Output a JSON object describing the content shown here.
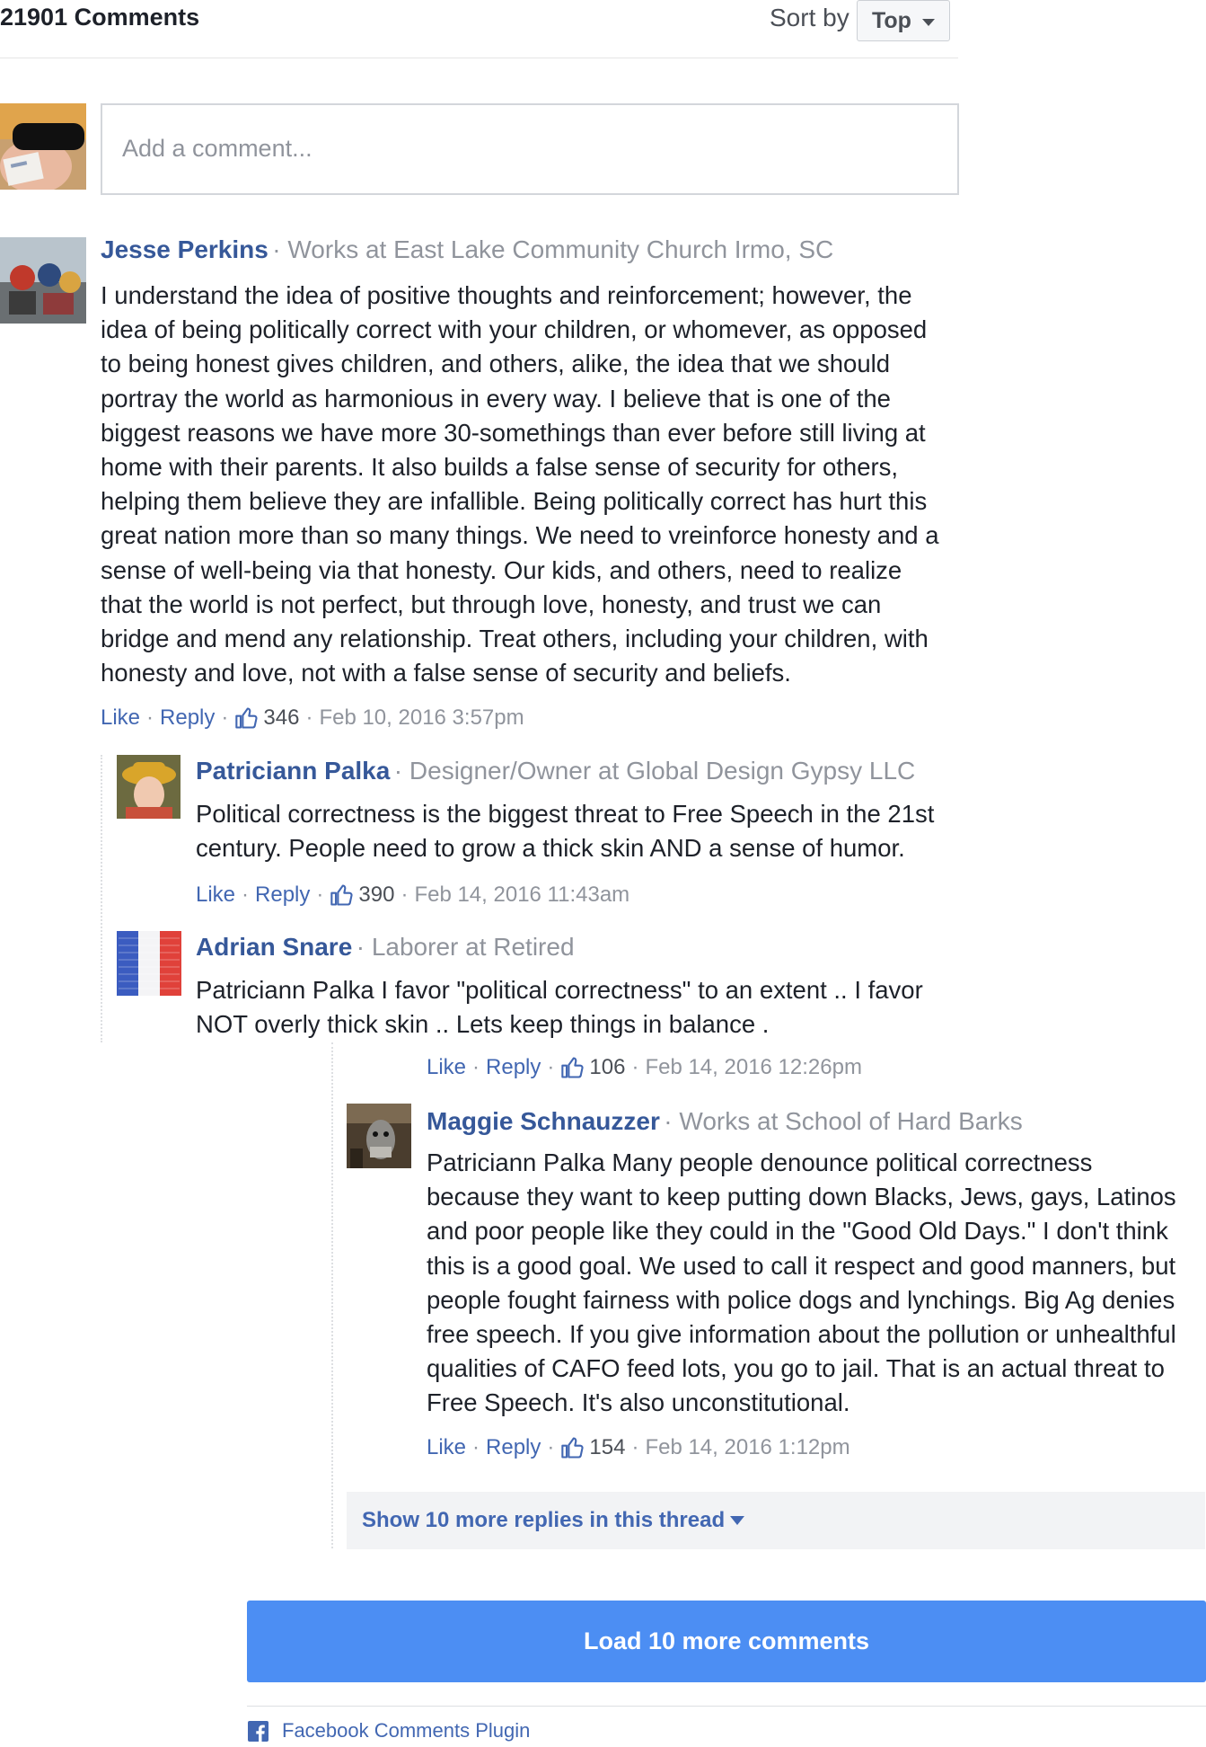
{
  "header": {
    "comment_count": "21901 Comments",
    "sort_label": "Sort by",
    "sort_value": "Top"
  },
  "composer": {
    "placeholder": "Add a comment..."
  },
  "comments": [
    {
      "name": "Jesse Perkins",
      "meta": "· Works at East Lake Community Church Irmo, SC",
      "lines": [
        "I understand the idea of positive thoughts and reinforcement; however, the",
        "idea of being politically correct with your children, or whomever, as opposed",
        "to being honest gives children, and others, alike, the idea that we should",
        "portray the world as harmonious in every way. I believe that is one of the",
        "biggest reasons we have more 30-somethings than ever before still living at",
        "home with their parents. It also builds a false sense of security for others,",
        "helping them believe they are infallible. Being politically correct has hurt this",
        "great nation more than so many things. We need to vreinforce honesty and a",
        "sense of well-being via that honesty. Our kids, and others, need to realize",
        "that the world is not perfect, but through love, honesty, and trust we can",
        "bridge and mend any relationship. Treat others, including your children, with",
        "honesty and love, not with a false sense of security and beliefs."
      ],
      "like": "Like",
      "reply": "Reply",
      "likes": "346",
      "timestamp": "Feb 10, 2016 3:57pm"
    },
    {
      "name": "Patriciann Palka",
      "meta": "· Designer/Owner at Global Design Gypsy LLC",
      "lines": [
        "Political correctness is the biggest threat to Free Speech in the 21st",
        "century. People need to grow a thick skin AND a sense of humor."
      ],
      "like": "Like",
      "reply": "Reply",
      "likes": "390",
      "timestamp": "Feb 14, 2016 11:43am"
    },
    {
      "name": "Adrian Snare",
      "meta": "· Laborer at Retired",
      "lines": [
        "Patriciann Palka I favor \"political correctness\" to an extent .. I favor",
        "NOT overly thick skin .. Lets keep things in balance ."
      ],
      "like": "Like",
      "reply": "Reply",
      "likes": "106",
      "timestamp": "Feb 14, 2016 12:26pm"
    },
    {
      "name": "Maggie Schnauzzer",
      "meta": "· Works at School of Hard Barks",
      "lines": [
        "Patriciann Palka Many people denounce political correctness",
        "because they want to keep putting down Blacks, Jews, gays, Latinos",
        "and poor people like they could in the \"Good Old Days.\" I don't think",
        "this is a good goal. We used to call it respect and good manners, but",
        "people fought fairness with police dogs and lynchings. Big Ag denies",
        "free speech. If you give information about the pollution or unhealthful",
        "qualities of CAFO feed lots, you go to jail. That is an actual threat to",
        "Free Speech. It's also unconstitutional."
      ],
      "like": "Like",
      "reply": "Reply",
      "likes": "154",
      "timestamp": "Feb 14, 2016 1:12pm"
    }
  ],
  "show_more_replies": "Show 10 more replies in this thread",
  "load_more": "Load 10 more comments",
  "footer": "Facebook Comments Plugin",
  "colors": {
    "link_blue": "#365899",
    "action_blue": "#4267b2",
    "load_button": "#4c8ef3",
    "meta_gray": "#90949c"
  },
  "icons": [
    "chevron-down-icon",
    "thumbs-up-icon",
    "facebook-logo-icon"
  ]
}
